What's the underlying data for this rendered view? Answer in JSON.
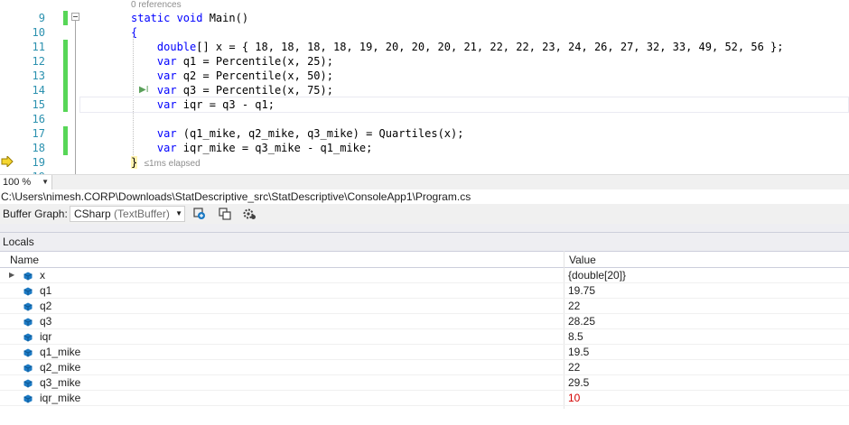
{
  "editor": {
    "references_label": "0 references",
    "elapsed_label": "≤1ms elapsed",
    "lines": [
      {
        "num": "9",
        "tokens": [
          {
            "t": "static void ",
            "k": "kw"
          },
          {
            "t": "Main()",
            "k": ""
          }
        ]
      },
      {
        "num": "10",
        "tokens": [
          {
            "t": "{",
            "k": "brace"
          }
        ]
      },
      {
        "num": "11",
        "tokens": [
          {
            "t": "    double",
            "k": "kw"
          },
          {
            "t": "[] x = { 18, 18, 18, 18, 19, 20, 20, 20, 21, 22, 22, 23, 24, 26, 27, 32, 33, 49, 52, 56 };",
            "k": ""
          }
        ]
      },
      {
        "num": "12",
        "tokens": [
          {
            "t": "    var",
            "k": "kw"
          },
          {
            "t": " q1 = Percentile(x, 25);",
            "k": ""
          }
        ]
      },
      {
        "num": "13",
        "tokens": [
          {
            "t": "    var",
            "k": "kw"
          },
          {
            "t": " q2 = Percentile(x, 50);",
            "k": ""
          }
        ]
      },
      {
        "num": "14",
        "tokens": [
          {
            "t": "    var",
            "k": "kw"
          },
          {
            "t": " q3 = Percentile(x, 75);",
            "k": ""
          }
        ]
      },
      {
        "num": "15",
        "tokens": [
          {
            "t": "    var",
            "k": "kw"
          },
          {
            "t": " iqr = q3 - q1;",
            "k": ""
          }
        ]
      },
      {
        "num": "16",
        "tokens": []
      },
      {
        "num": "17",
        "tokens": [
          {
            "t": "    var",
            "k": "kw"
          },
          {
            "t": " (q1_mike, q2_mike, q3_mike) = Quartiles(x);",
            "k": ""
          }
        ]
      },
      {
        "num": "18",
        "tokens": [
          {
            "t": "    var",
            "k": "kw"
          },
          {
            "t": " iqr_mike = q3_mike - q1_mike;",
            "k": ""
          }
        ]
      },
      {
        "num": "19",
        "tokens": [
          {
            "t": "}",
            "k": "bracehl"
          }
        ]
      },
      {
        "num": "19",
        "tokens": []
      }
    ]
  },
  "zoom": {
    "value": "100 %"
  },
  "file_path": "C:\\Users\\nimesh.CORP\\Downloads\\StatDescriptive_src\\StatDescriptive\\ConsoleApp1\\Program.cs",
  "buffer_graph": {
    "label": "Buffer Graph:",
    "selected_main": "CSharp",
    "selected_sub": "(TextBuffer)"
  },
  "locals": {
    "title": "Locals",
    "col_name": "Name",
    "col_value": "Value",
    "rows": [
      {
        "name": "x",
        "value": "{double[20]}",
        "expandable": true,
        "changed": false
      },
      {
        "name": "q1",
        "value": "19.75",
        "expandable": false,
        "changed": false
      },
      {
        "name": "q2",
        "value": "22",
        "expandable": false,
        "changed": false
      },
      {
        "name": "q3",
        "value": "28.25",
        "expandable": false,
        "changed": false
      },
      {
        "name": "iqr",
        "value": "8.5",
        "expandable": false,
        "changed": false
      },
      {
        "name": "q1_mike",
        "value": "19.5",
        "expandable": false,
        "changed": false
      },
      {
        "name": "q2_mike",
        "value": "22",
        "expandable": false,
        "changed": false
      },
      {
        "name": "q3_mike",
        "value": "29.5",
        "expandable": false,
        "changed": false
      },
      {
        "name": "iqr_mike",
        "value": "10",
        "expandable": false,
        "changed": true
      }
    ]
  },
  "colors": {
    "keyword": "#0000ff",
    "line_number": "#2b91af",
    "change_bar": "#57d657",
    "changed_value": "#d40000",
    "field_icon": "#1c7ac4"
  },
  "icons": [
    "collapse-icon",
    "execution-arrow-icon",
    "run-to-cursor-icon",
    "dropdown-arrow-icon",
    "toolbar-graph-icon",
    "toolbar-copy-icon",
    "toolbar-settings-icon",
    "expand-arrow-icon",
    "field-icon"
  ]
}
